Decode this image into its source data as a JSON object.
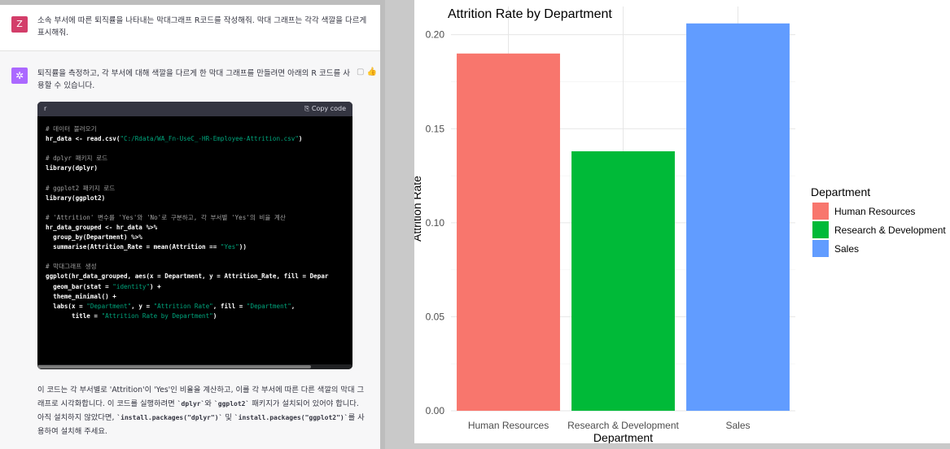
{
  "chat": {
    "user_avatar_letter": "Z",
    "user_message": "소속 부서에 따른 퇴직률을 나타내는 막대그래프 R코드를 작성해줘. 막대 그래프는 각각 색깔을 다르게 표시해줘.",
    "assistant_intro": "퇴직률을 측정하고, 각 부서에 대해 색깔을 다르게 한 막대 그래프를 만들려면 아래의 R 코드를 사용할 수 있습니다.",
    "code_language": "r",
    "copy_label": "Copy code",
    "code_lines": [
      {
        "t": "cm",
        "s": "# 데이터 불러오기"
      },
      {
        "t": "mix",
        "a": "hr_data <- read.csv(",
        "b": "\"C:/Rdata/WA_Fn-UseC_-HR-Employee-Attrition.csv\"",
        "c": ")"
      },
      {
        "t": "blank",
        "s": ""
      },
      {
        "t": "cm",
        "s": "# dplyr 패키지 로드"
      },
      {
        "t": "code",
        "s": "library(dplyr)"
      },
      {
        "t": "blank",
        "s": ""
      },
      {
        "t": "cm",
        "s": "# ggplot2 패키지 로드"
      },
      {
        "t": "code",
        "s": "library(ggplot2)"
      },
      {
        "t": "blank",
        "s": ""
      },
      {
        "t": "cm",
        "s": "# 'Attrition' 변수를 'Yes'와 'No'로 구분하고, 각 부서별 'Yes'의 비율 계산"
      },
      {
        "t": "code",
        "s": "hr_data_grouped <- hr_data %>%"
      },
      {
        "t": "code",
        "s": "  group_by(Department) %>%"
      },
      {
        "t": "mix",
        "a": "  summarise(Attrition_Rate = mean(Attrition == ",
        "b": "\"Yes\"",
        "c": "))"
      },
      {
        "t": "blank",
        "s": ""
      },
      {
        "t": "cm",
        "s": "# 막대그래프 생성"
      },
      {
        "t": "code",
        "s": "ggplot(hr_data_grouped, aes(x = Department, y = Attrition_Rate, fill = Depar"
      },
      {
        "t": "mix",
        "a": "  geom_bar(stat = ",
        "b": "\"identity\"",
        "c": ") +"
      },
      {
        "t": "code",
        "s": "  theme_minimal() +"
      },
      {
        "t": "mix4",
        "a": "  labs(x = ",
        "b": "\"Department\"",
        "c": ", y = ",
        "d": "\"Attrition Rate\"",
        "e": ", fill = ",
        "f": "\"Department\"",
        "g": ","
      },
      {
        "t": "mix",
        "a": "       title = ",
        "b": "\"Attrition Rate by Department\"",
        "c": ")"
      }
    ],
    "outro_1": "이 코드는 각 부서별로 'Attrition'이 'Yes'인 비율을 계산하고, 이를 각 부서에 따른 다른 색깔의 막대 그래프로 시각화합니다. 이 코드를 실행하려면 ",
    "outro_code_1": "`dplyr`",
    "outro_2": "와 ",
    "outro_code_2": "`ggplot2`",
    "outro_3": " 패키지가 설치되어 있어야 합니다. 아직 설치하지 않았다면, ",
    "outro_code_3": "`install.packages(\"dplyr\")`",
    "outro_4": " 및 ",
    "outro_code_4": "`install.packages(\"ggplot2\")`",
    "outro_5": "를 사용하여 설치해 주세요."
  },
  "chart_data": {
    "type": "bar",
    "title": "Attrition Rate by Department",
    "xlabel": "Department",
    "ylabel": "Attrition Rate",
    "categories": [
      "Human Resources",
      "Research & Development",
      "Sales"
    ],
    "values": [
      0.19,
      0.138,
      0.206
    ],
    "colors": [
      "#F8766D",
      "#00BA38",
      "#619CFF"
    ],
    "ylim": [
      0,
      0.215
    ],
    "yticks": [
      "0.00",
      "0.05",
      "0.10",
      "0.15",
      "0.20"
    ],
    "ytick_values": [
      0,
      0.05,
      0.1,
      0.15,
      0.2
    ],
    "legend_title": "Department",
    "legend_position": "right",
    "grid": true
  }
}
